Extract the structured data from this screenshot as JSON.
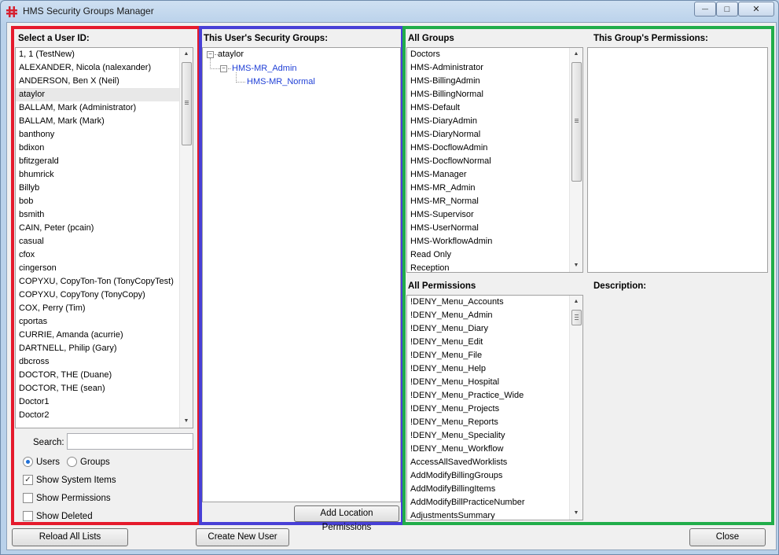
{
  "window": {
    "title": "HMS Security Groups Manager",
    "controls": {
      "minimize": "—",
      "maximize": "□",
      "close": "✕"
    }
  },
  "users": {
    "header": "Select a User ID:",
    "items": [
      "1, 1 (TestNew)",
      "ALEXANDER, Nicola (nalexander)",
      "ANDERSON, Ben X (Neil)",
      "ataylor",
      "BALLAM, Mark (Administrator)",
      "BALLAM, Mark (Mark)",
      "banthony",
      "bdixon",
      "bfitzgerald",
      "bhumrick",
      "Billyb",
      "bob",
      "bsmith",
      "CAIN, Peter (pcain)",
      "casual",
      "cfox",
      "cingerson",
      "COPYXU, CopyTon-Ton (TonyCopyTest)",
      "COPYXU, CopyTony (TonyCopy)",
      "COX, Perry (Tim)",
      "cportas",
      "CURRIE, Amanda (acurrie)",
      "DARTNELL, Philip (Gary)",
      "dbcross",
      "DOCTOR, THE (Duane)",
      "DOCTOR, THE (sean)",
      "Doctor1",
      "Doctor2"
    ],
    "selected_index": 3,
    "search_label": "Search:",
    "search_value": "",
    "radio_users": "Users",
    "radio_groups": "Groups",
    "show_system_items": "Show System Items",
    "show_permissions": "Show Permissions",
    "show_deleted": "Show Deleted"
  },
  "user_groups": {
    "header": "This User's Security Groups:",
    "root": "ataylor",
    "child": "HMS-MR_Admin",
    "grandchild": "HMS-MR_Normal",
    "add_location_button": "Add Location Permissions"
  },
  "all_groups": {
    "header": "All Groups",
    "items": [
      "Doctors",
      "HMS-Administrator",
      "HMS-BillingAdmin",
      "HMS-BillingNormal",
      "HMS-Default",
      "HMS-DiaryAdmin",
      "HMS-DiaryNormal",
      "HMS-DocflowAdmin",
      "HMS-DocflowNormal",
      "HMS-Manager",
      "HMS-MR_Admin",
      "HMS-MR_Normal",
      "HMS-Supervisor",
      "HMS-UserNormal",
      "HMS-WorkflowAdmin",
      "Read Only",
      "Reception"
    ]
  },
  "group_permissions": {
    "header": "This Group's Permissions:"
  },
  "all_permissions": {
    "header": "All Permissions",
    "items": [
      "!DENY_Menu_Accounts",
      "!DENY_Menu_Admin",
      "!DENY_Menu_Diary",
      "!DENY_Menu_Edit",
      "!DENY_Menu_File",
      "!DENY_Menu_Help",
      "!DENY_Menu_Hospital",
      "!DENY_Menu_Practice_Wide",
      "!DENY_Menu_Projects",
      "!DENY_Menu_Reports",
      "!DENY_Menu_Speciality",
      "!DENY_Menu_Workflow",
      "AccessAllSavedWorklists",
      "AddModifyBillingGroups",
      "AddModifyBillingItems",
      "AddModifyBillPracticeNumber",
      "AdjustmentsSummary"
    ]
  },
  "description": {
    "header": "Description:"
  },
  "footer": {
    "reload_button": "Reload All Lists",
    "create_user_button": "Create New User",
    "close_button": "Close"
  },
  "colors": {
    "users_frame": "#e51a2c",
    "groups_frame": "#4840d6",
    "catalog_frame": "#21ad4a",
    "tree_child_text": "#1f3fd6"
  }
}
